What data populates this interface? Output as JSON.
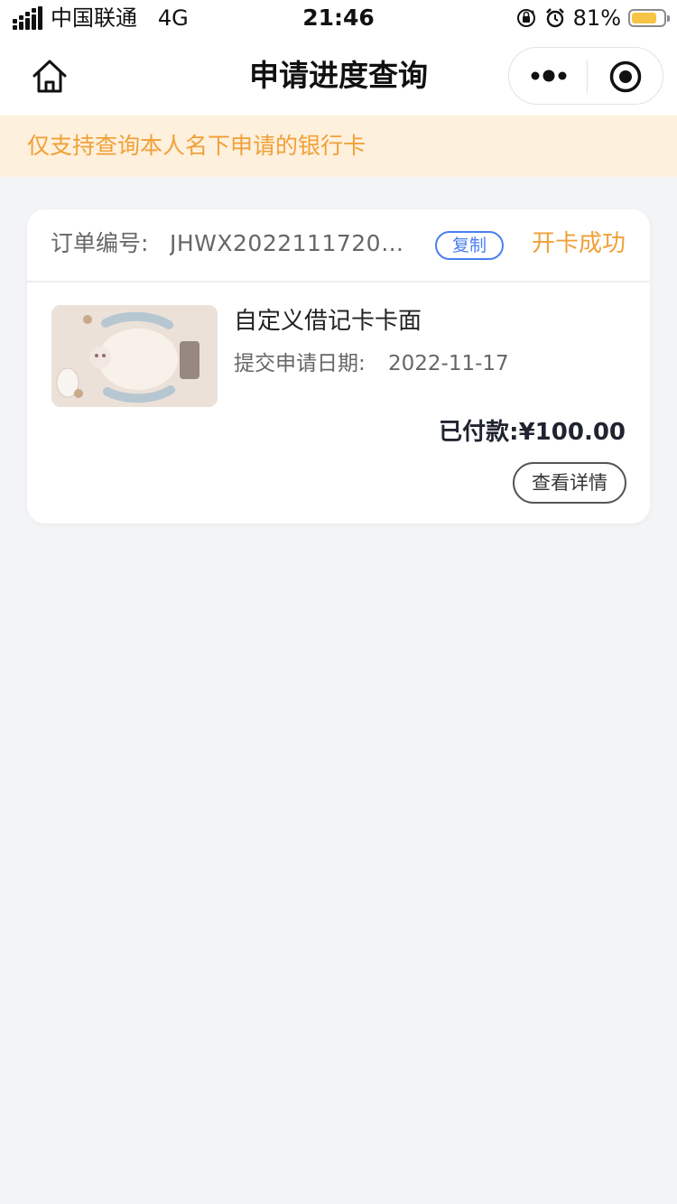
{
  "status_bar": {
    "carrier": "中国联通",
    "network": "4G",
    "time": "21:46",
    "battery_percent": "81%",
    "battery_level": 0.81,
    "battery_color": "#f6c545",
    "icons": [
      "signal-icon",
      "rotation-lock-icon",
      "alarm-icon",
      "battery-icon"
    ]
  },
  "nav": {
    "title": "申请进度查询",
    "home_icon": "home-icon",
    "more_icon": "more-dots-icon",
    "close_icon": "target-close-icon"
  },
  "notice": {
    "text": "仅支持查询本人名下申请的银行卡",
    "background": "#fdf0dc",
    "color": "#f0a038"
  },
  "order": {
    "number_label": "订单编号:",
    "number": "JHWX20221117200...",
    "copy_label": "复制",
    "status": "开卡成功",
    "product_name": "自定义借记卡卡面",
    "submit_label": "提交申请日期:",
    "submit_date": "2022-11-17",
    "paid_label": "已付款:",
    "paid_amount": "¥100.00",
    "detail_label": "查看详情"
  },
  "colors": {
    "accent_orange": "#f0a038",
    "accent_blue": "#4a7ff0",
    "page_bg": "#f3f4f6"
  }
}
